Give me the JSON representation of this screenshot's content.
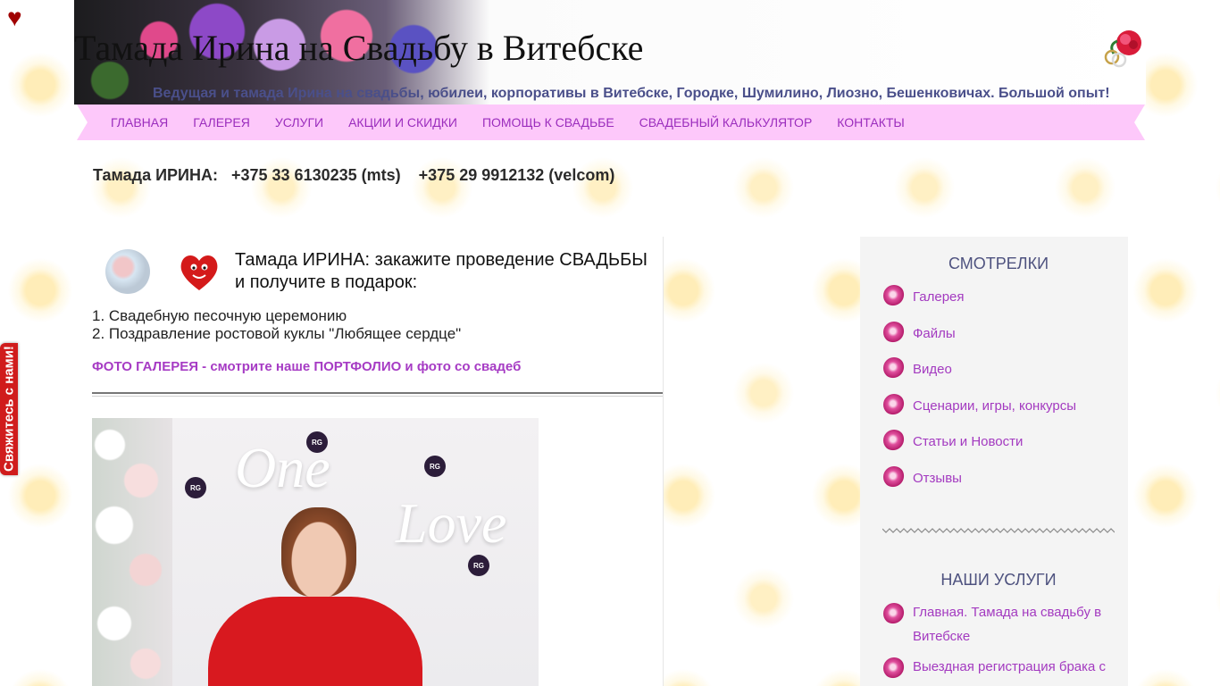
{
  "site": {
    "title": "Тамада Ирина на Свадьбу в Витебске",
    "tagline": "Ведущая и тамада Ирина на свадьбы, юбилеи, корпоративы в Витебске, Городке, Шумилино, Лиозно, Бешенковичах. Большой опыт!",
    "header_icons": [
      "heart-icon",
      "rings-icon"
    ]
  },
  "side_tab": {
    "label": "Свяжитесь с нами!"
  },
  "nav": {
    "items": [
      "ГЛАВНАЯ",
      "ГАЛЕРЕЯ",
      "УСЛУГИ",
      "АКЦИИ И СКИДКИ",
      "ПОМОЩЬ К СВАДЬБЕ",
      "СВАДЕБНЫЙ КАЛЬКУЛЯТОР",
      "КОНТАКТЫ"
    ]
  },
  "contacts": {
    "label": "Тамада ИРИНА:",
    "phone_mts": "+375 33 6130235 (mts)",
    "phone_velcom": "+375 29 9912132 (velcom)"
  },
  "post": {
    "title": "Тамада ИРИНА: закажите проведение СВАДЬБЫ и получите в подарок:",
    "gifts": [
      "1. Свадебную песочную церемонию",
      "2. Поздравление ростовой куклы \"Любящее сердце\""
    ],
    "portfolio_link": "ФОТО ГАЛЕРЕЯ - смотрите наше ПОРТФОЛИО и фото со свадеб",
    "photo_text_1": "One",
    "photo_text_2": "Love",
    "badge_text": "RG"
  },
  "sidebar": {
    "widget1": {
      "title": "СМОТРЕЛКИ",
      "items": [
        "Галерея",
        "Файлы",
        "Видео",
        "Сценарии, игры, конкурсы",
        "Статьи и Новости",
        "Отзывы"
      ]
    },
    "widget2": {
      "title": "НАШИ УСЛУГИ",
      "items": [
        "Главная. Тамада на свадьбу в Витебске",
        "Выездная регистрация брака с"
      ]
    }
  },
  "colors": {
    "nav_bg": "#fdc8fa",
    "nav_text": "#9b2dbd",
    "link": "#a33ac0",
    "widget_title": "#4e527f",
    "tagline": "#4a4f8a",
    "side_tab": "#d01c1c"
  }
}
